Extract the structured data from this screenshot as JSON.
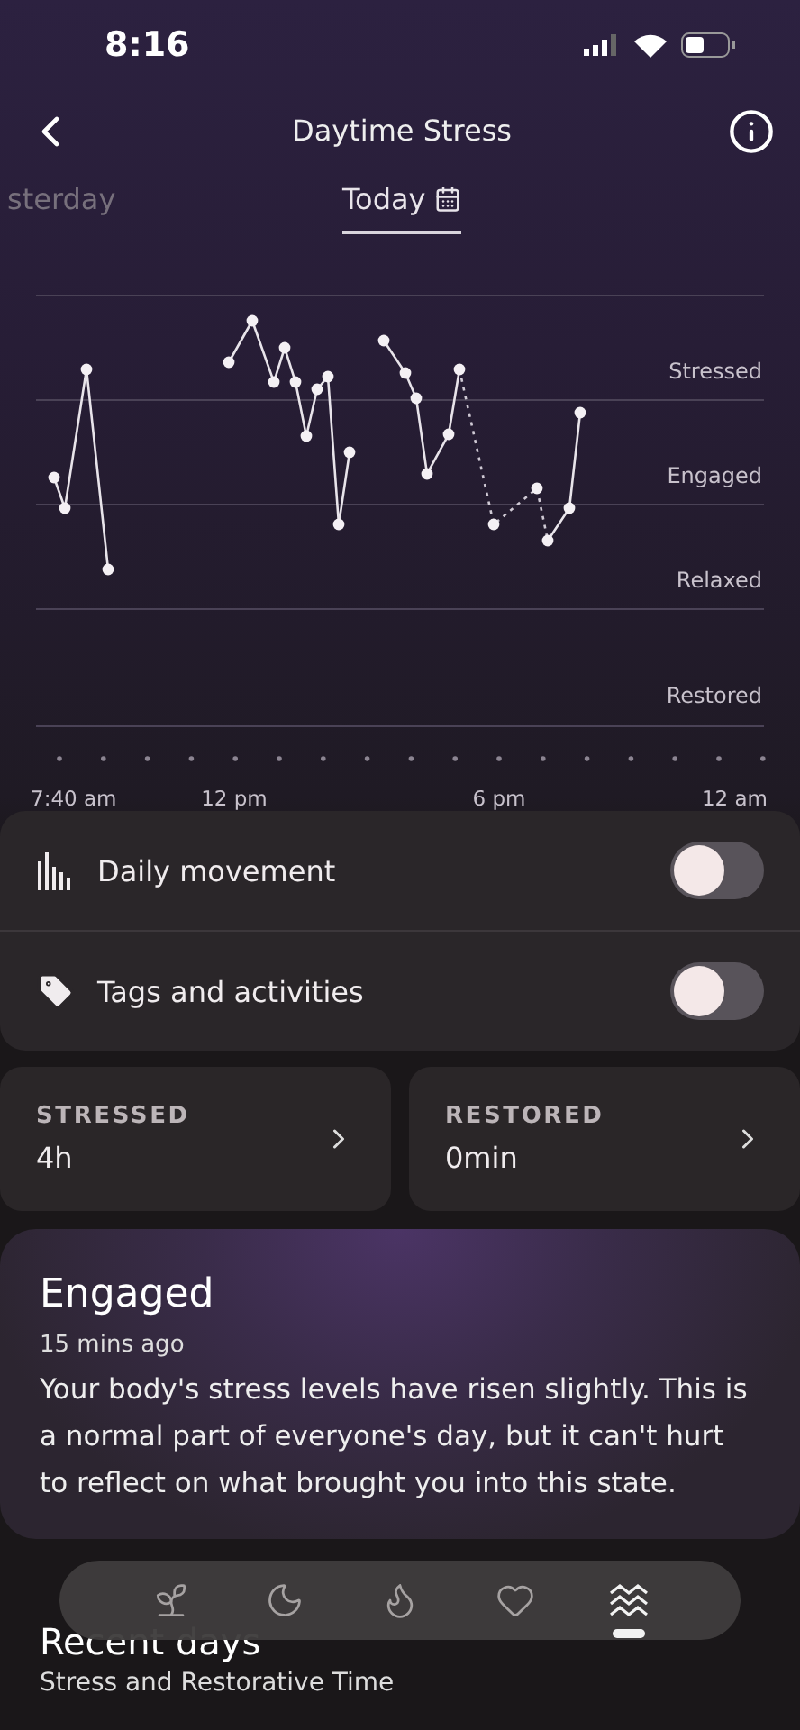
{
  "status_bar": {
    "time": "8:16"
  },
  "header": {
    "title": "Daytime Stress"
  },
  "date_tabs": [
    {
      "label": "sterday",
      "selected": false
    },
    {
      "label": "Today",
      "selected": true
    }
  ],
  "chart": {
    "levels": [
      "Stressed",
      "Engaged",
      "Relaxed",
      "Restored"
    ],
    "time_labels": [
      "7:40 am",
      "12 pm",
      "6 pm",
      "12 am"
    ]
  },
  "toggles": [
    {
      "kind": "movement",
      "label": "Daily movement",
      "on": false
    },
    {
      "kind": "tags",
      "label": "Tags and activities",
      "on": false
    }
  ],
  "summary_cards": [
    {
      "label": "STRESSED",
      "value": "4h"
    },
    {
      "label": "RESTORED",
      "value": "0min"
    }
  ],
  "state_card": {
    "title": "Engaged",
    "time": "15 mins ago",
    "body": "Your body's stress levels have risen slightly. This is a normal part of everyone's day, but it can't hurt to reflect on what brought you into this state."
  },
  "recent": {
    "title": "Recent days",
    "subtitle": "Stress and Restorative Time"
  },
  "tab_bar": [
    {
      "kind": "sprout",
      "selected": false
    },
    {
      "kind": "moon",
      "selected": false
    },
    {
      "kind": "flame",
      "selected": false
    },
    {
      "kind": "heart",
      "selected": false
    },
    {
      "kind": "waves",
      "selected": true
    }
  ]
}
